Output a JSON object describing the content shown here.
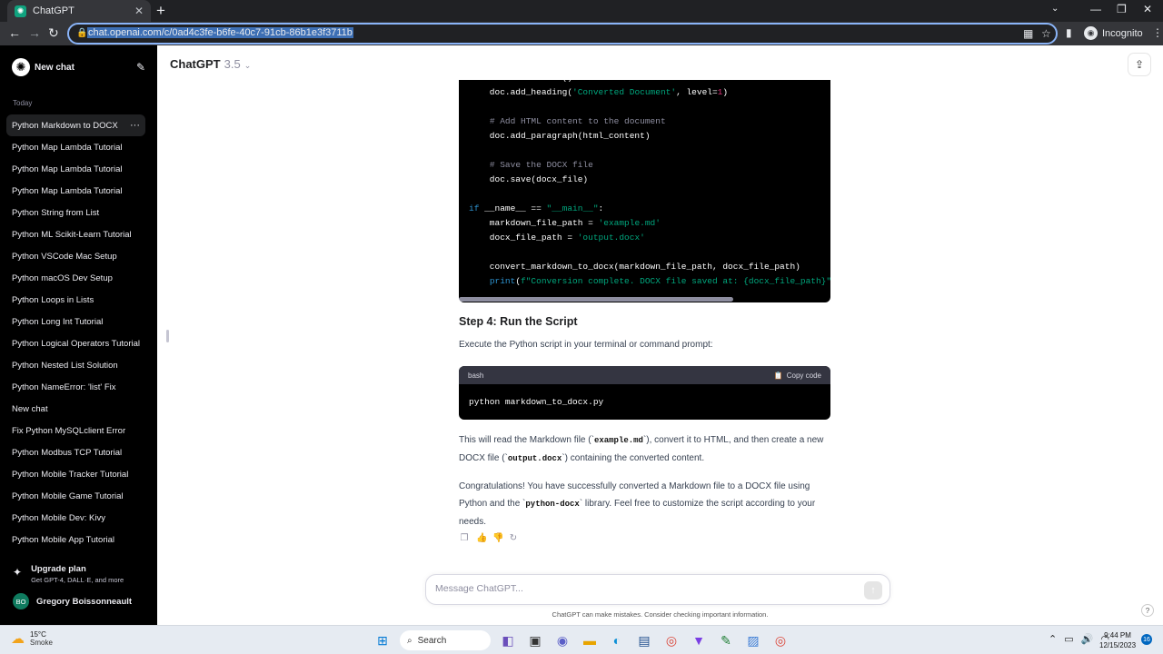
{
  "browser": {
    "tab_title": "ChatGPT",
    "url": "chat.openai.com/c/0ad4c3fe-b6fe-40c7-91cb-86b1e3f3711b",
    "profile_label": "Incognito"
  },
  "sidebar": {
    "new_chat_label": "New chat",
    "section_label": "Today",
    "items": [
      {
        "label": "Python Markdown to DOCX"
      },
      {
        "label": "Python Map Lambda Tutorial"
      },
      {
        "label": "Python Map Lambda Tutorial"
      },
      {
        "label": "Python Map Lambda Tutorial"
      },
      {
        "label": "Python String from List"
      },
      {
        "label": "Python ML Scikit-Learn Tutorial"
      },
      {
        "label": "Python VSCode Mac Setup"
      },
      {
        "label": "Python macOS Dev Setup"
      },
      {
        "label": "Python Loops in Lists"
      },
      {
        "label": "Python Long Int Tutorial"
      },
      {
        "label": "Python Logical Operators Tutorial"
      },
      {
        "label": "Python Nested List Solution"
      },
      {
        "label": "Python NameError: 'list' Fix"
      },
      {
        "label": "New chat"
      },
      {
        "label": "Fix Python MySQLclient Error"
      },
      {
        "label": "Python Modbus TCP Tutorial"
      },
      {
        "label": "Python Mobile Tracker Tutorial"
      },
      {
        "label": "Python Mobile Game Tutorial"
      },
      {
        "label": "Python Mobile Dev: Kivy"
      },
      {
        "label": "Python Mobile App Tutorial"
      }
    ],
    "upgrade_title": "Upgrade plan",
    "upgrade_subtitle": "Get GPT-4, DALL·E, and more",
    "user_initials": "BO",
    "user_name": "Gregory Boissonneault"
  },
  "header": {
    "model_name": "ChatGPT",
    "model_version": "3.5"
  },
  "content": {
    "step_heading": "Step 4: Run the Script",
    "step_text": "Execute the Python script in your terminal or command prompt:",
    "code_lang": "bash",
    "copy_label": "Copy code",
    "command": "python markdown_to_docx.py",
    "para2_a": "This will read the Markdown file (`",
    "para2_code1": "example.md",
    "para2_b": "`), convert it to HTML, and then create a new DOCX file (`",
    "para2_code2": "output.docx",
    "para2_c": "`) containing the converted content.",
    "para3_a": "Congratulations! You have successfully converted a Markdown file to a DOCX file using Python and the `",
    "para3_code": "python-docx",
    "para3_b": "` library. Feel free to customize the script according to your needs."
  },
  "composer": {
    "placeholder": "Message ChatGPT...",
    "disclaimer": "ChatGPT can make mistakes. Consider checking important information."
  },
  "taskbar": {
    "temperature": "15°C",
    "condition": "Smoke",
    "search_label": "Search",
    "time": "9:44 PM",
    "date": "12/15/2023",
    "notification_count": "16"
  },
  "colors": {
    "code_keyword": "#2e95d3",
    "code_string": "#00a67d",
    "code_comment": "#8e8ea0",
    "code_number": "#df3079",
    "sidebar_bg": "#000000"
  }
}
